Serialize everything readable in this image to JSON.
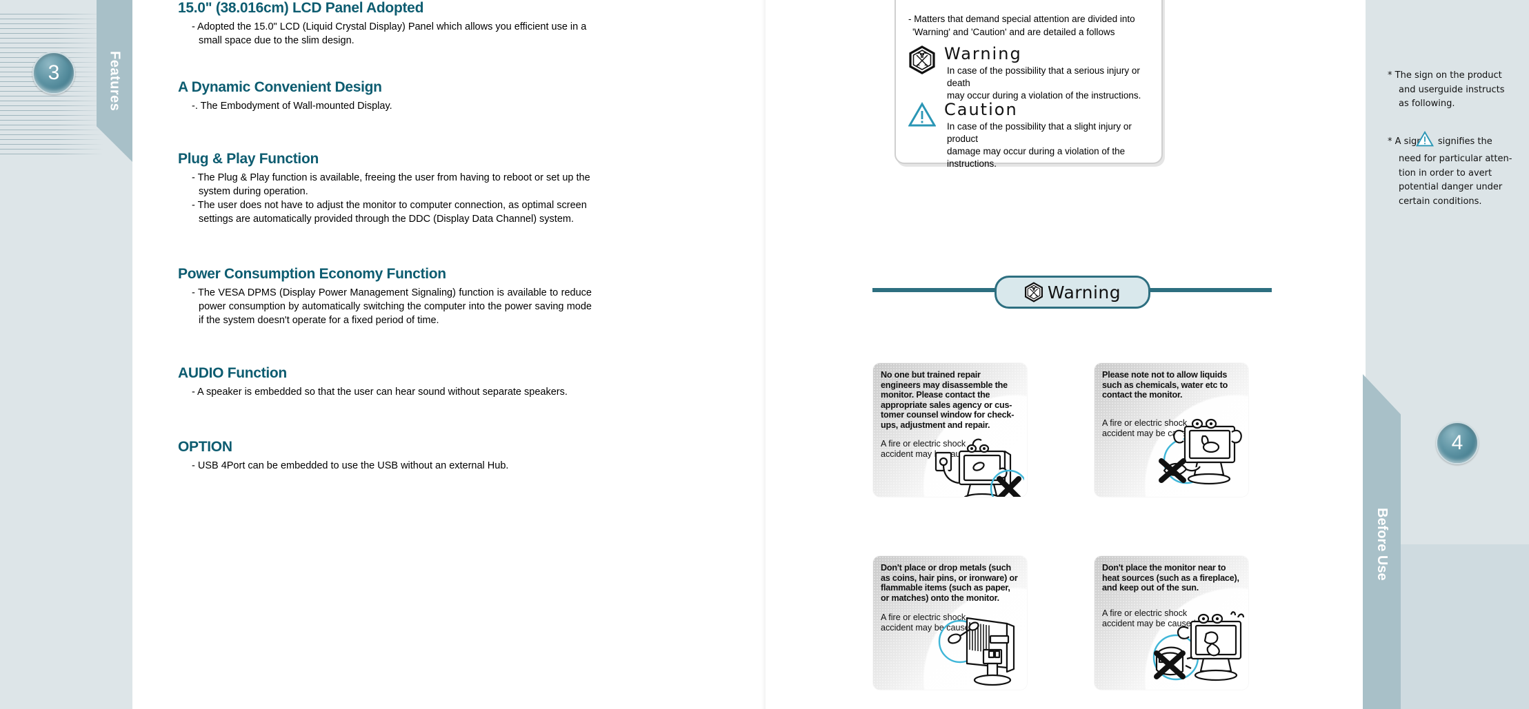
{
  "left_page": {
    "page_number": "3",
    "tab_label": "Features",
    "sections": [
      {
        "title": "15.0\"  (38.016cm) LCD Panel Adopted",
        "bullets": [
          "- Adopted the 15.0\" LCD (Liquid Crystal Display) Panel which allows you efficient use in a small space due to the slim design."
        ]
      },
      {
        "title": "A Dynamic Convenient Design",
        "bullets": [
          "-. The Embodyment of Wall-mounted Display."
        ]
      },
      {
        "title": "Plug & Play Function",
        "bullets": [
          "-  The Plug & Play function is available, freeing the user from having to reboot or set up the system during operation.",
          "- The user  does not  have to  adjust the monitor  to computer  connection, as optimal screen  settings are  automatically provided  through the  DDC (Display Data Channel) system."
        ]
      },
      {
        "title": "Power Consumption Economy Function",
        "bullets": [
          "- The  VESA  DPMS  (Display  Power  Management  Signaling)  function  is available to reduce power consumption by automatically  switching the computer into the power saving mode if the system  doesn't operate for a fixed period of time."
        ]
      },
      {
        "title": "AUDIO Function",
        "bullets": [
          "- A speaker  is embedded   so that the   user can hear   sound without separate speakers."
        ]
      },
      {
        "title": "OPTION",
        "bullets": [
          "- USB 4Port can be embedded to use the USB without an external Hub."
        ]
      }
    ]
  },
  "right_page": {
    "page_number": "4",
    "tab_label": "Before Use",
    "notice_box": {
      "intro_line1": "- Matters  that  demand  special   attention are   divided into",
      "intro_line2": "'Warning'  and  'Caution' and are detailed a follows",
      "signs": [
        {
          "icon": "warning-hex-icon",
          "title": "Warning",
          "body_line1": "In case of  the possibility that  a serious  injury or death",
          "body_line2": "may occur  during a violation of the instructions."
        },
        {
          "icon": "caution-triangle-icon",
          "title": "Caution",
          "body_line1": "In case of  the possibility  that a  slight injury  or product",
          "body_line2": "damage may occur during a violation of the instructions."
        }
      ]
    },
    "banner": {
      "icon": "warning-hex-icon",
      "label": "Warning"
    },
    "warning_cards": [
      {
        "heading": "No one but trained repair engineers may disassemble the monitor. Please contact the appropriate sales agency  or cus-tomer counsel window for check-ups, adjustment and repair.",
        "consequence": "A fire or electric shock accident may be caused.",
        "illustration": "monitor-plug-character-illustration"
      },
      {
        "heading": "Please note not  to allow  liquids such as  chemicals, water  etc to contact the monitor.",
        "consequence": "A fire or electric shock accident may be caused.",
        "illustration": "monitor-liquid-spill-illustration"
      },
      {
        "heading": "Don't place or drop metals (such as coins, hair  pins, or ironware) or flammable items (such as paper, or matches) onto the monitor.",
        "consequence": "A fire or electric shock accident may be caused.",
        "illustration": "monitor-vent-metal-drop-illustration"
      },
      {
        "heading": "Don't place the monitor near to heat sources (such as a fireplace), and keep out of the sun.",
        "consequence": "A fire or electric shock accident may be caused.",
        "illustration": "monitor-heat-source-illustration"
      }
    ],
    "notes": [
      {
        "marker": "*",
        "line1": "The sign on the product",
        "line2": "and userguide instructs",
        "line3": "as following."
      },
      {
        "marker": "*",
        "pre": "A  sign",
        "post": "signifies the",
        "line2": "need  for particular atten-",
        "line3": "tion in  order to  avert",
        "line4": "potential danger under",
        "line5": "certain conditions."
      }
    ]
  },
  "colors": {
    "heading_teal": "#0d5c70",
    "tab_blue": "#a8c0c8",
    "panel_pale": "#dde5e8",
    "rule_teal": "#2d6f80",
    "pill_fill": "#d9e8ec",
    "caution_blue": "#2a96b5"
  }
}
